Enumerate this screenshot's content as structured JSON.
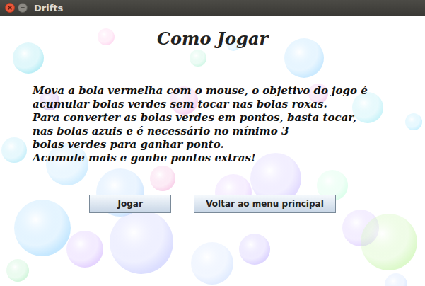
{
  "window": {
    "title": "Drifts"
  },
  "heading": "Como Jogar",
  "instructions": [
    "Mova a bola vermelha com o mouse, o objetivo do jogo é",
    "acumular bolas verdes sem tocar nas bolas roxas.",
    "Para converter as bolas verdes em pontos, basta tocar,",
    "nas bolas azuis e é necessário no mínimo 3",
    "bolas verdes para ganhar ponto.",
    "Acumule mais e ganhe pontos extras!"
  ],
  "buttons": [
    "Jogar",
    "Voltar ao menu principal"
  ]
}
